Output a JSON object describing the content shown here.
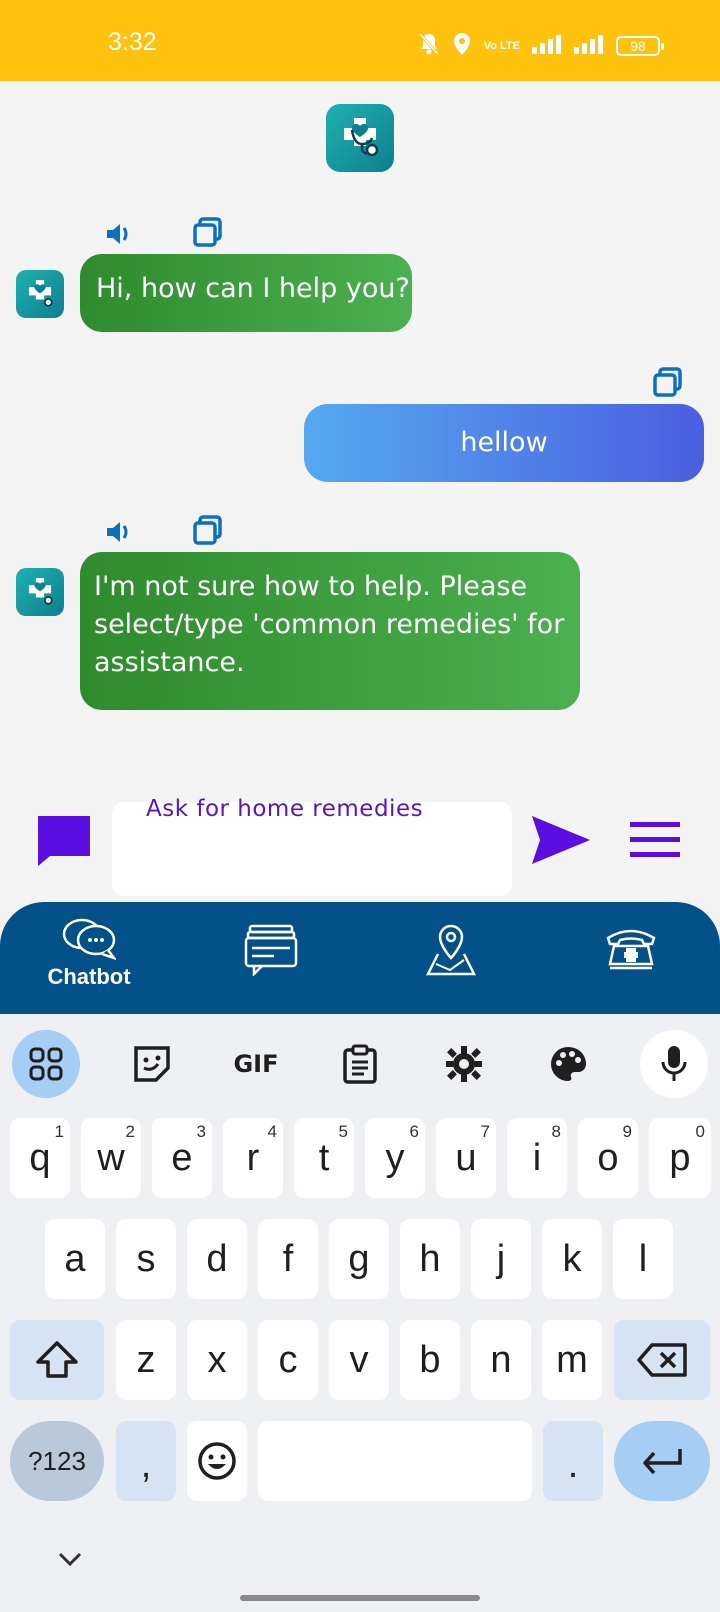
{
  "status_bar": {
    "time": "3:32",
    "battery": "98",
    "network_label": "Vo LTE"
  },
  "chat": {
    "messages": [
      {
        "from": "bot",
        "text": "Hi, how can I help you?"
      },
      {
        "from": "user",
        "text": "hellow"
      },
      {
        "from": "bot",
        "text_lines": [
          "I'm not sure how to help. Please",
          "select/type 'common remedies' for",
          "assistance."
        ]
      }
    ]
  },
  "input": {
    "placeholder": "Ask for home remedies"
  },
  "bottom_nav": {
    "items": [
      {
        "label": "Chatbot",
        "icon": "chat-bubbles-icon",
        "active": true
      },
      {
        "label": "",
        "icon": "news-list-icon"
      },
      {
        "label": "",
        "icon": "map-pin-icon"
      },
      {
        "label": "",
        "icon": "emergency-phone-icon"
      }
    ]
  },
  "keyboard": {
    "toolbar": [
      "apps-grid-icon",
      "sticker-icon",
      "GIF",
      "clipboard-icon",
      "settings-icon",
      "palette-icon",
      "mic-icon"
    ],
    "gif_label": "GIF",
    "row1": [
      {
        "k": "q",
        "h": "1"
      },
      {
        "k": "w",
        "h": "2"
      },
      {
        "k": "e",
        "h": "3"
      },
      {
        "k": "r",
        "h": "4"
      },
      {
        "k": "t",
        "h": "5"
      },
      {
        "k": "y",
        "h": "6"
      },
      {
        "k": "u",
        "h": "7"
      },
      {
        "k": "i",
        "h": "8"
      },
      {
        "k": "o",
        "h": "9"
      },
      {
        "k": "p",
        "h": "0"
      }
    ],
    "row2": [
      "a",
      "s",
      "d",
      "f",
      "g",
      "h",
      "j",
      "k",
      "l"
    ],
    "row3": [
      "z",
      "x",
      "c",
      "v",
      "b",
      "n",
      "m"
    ],
    "sym_label": "?123",
    "comma": ",",
    "period": "."
  },
  "colors": {
    "status_bar": "#ffc20e",
    "bot_bubble": "#3a9b3a",
    "user_bubble": "#4f83e8",
    "accent_purple": "#5b12c9",
    "nav_bar": "#045189"
  }
}
